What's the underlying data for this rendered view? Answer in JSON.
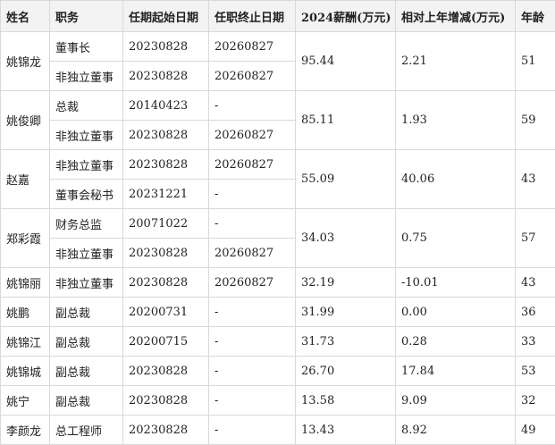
{
  "headers": [
    "姓名",
    "职务",
    "任期起始日期",
    "任职终止日期",
    "2024薪酬(万元)",
    "相对上年增减(万元)",
    "年龄"
  ],
  "people": [
    {
      "name": "姚锦龙",
      "salary": "95.44",
      "change": "2.21",
      "age": "51",
      "roles": [
        {
          "title": "董事长",
          "start": "20230828",
          "end": "20260827"
        },
        {
          "title": "非独立董事",
          "start": "20230828",
          "end": "20260827"
        }
      ]
    },
    {
      "name": "姚俊卿",
      "salary": "85.11",
      "change": "1.93",
      "age": "59",
      "roles": [
        {
          "title": "总裁",
          "start": "20140423",
          "end": "-"
        },
        {
          "title": "非独立董事",
          "start": "20230828",
          "end": "20260827"
        }
      ]
    },
    {
      "name": "赵嘉",
      "salary": "55.09",
      "change": "40.06",
      "age": "43",
      "roles": [
        {
          "title": "非独立董事",
          "start": "20230828",
          "end": "20260827"
        },
        {
          "title": "董事会秘书",
          "start": "20231221",
          "end": "-"
        }
      ]
    },
    {
      "name": "郑彩霞",
      "salary": "34.03",
      "change": "0.75",
      "age": "57",
      "roles": [
        {
          "title": "财务总监",
          "start": "20071022",
          "end": "-"
        },
        {
          "title": "非独立董事",
          "start": "20230828",
          "end": "20260827"
        }
      ]
    },
    {
      "name": "姚锦丽",
      "salary": "32.19",
      "change": "-10.01",
      "age": "43",
      "roles": [
        {
          "title": "非独立董事",
          "start": "20230828",
          "end": "20260827"
        }
      ]
    },
    {
      "name": "姚鹏",
      "salary": "31.99",
      "change": "0.00",
      "age": "36",
      "roles": [
        {
          "title": "副总裁",
          "start": "20200731",
          "end": "-"
        }
      ]
    },
    {
      "name": "姚锦江",
      "salary": "31.73",
      "change": "0.28",
      "age": "33",
      "roles": [
        {
          "title": "副总裁",
          "start": "20200715",
          "end": "-"
        }
      ]
    },
    {
      "name": "姚锦城",
      "salary": "26.70",
      "change": "17.84",
      "age": "53",
      "roles": [
        {
          "title": "副总裁",
          "start": "20230828",
          "end": "-"
        }
      ]
    },
    {
      "name": "姚宁",
      "salary": "13.58",
      "change": "9.09",
      "age": "32",
      "roles": [
        {
          "title": "副总裁",
          "start": "20230828",
          "end": "-"
        }
      ]
    },
    {
      "name": "李颜龙",
      "salary": "13.43",
      "change": "8.92",
      "age": "49",
      "roles": [
        {
          "title": "总工程师",
          "start": "20230828",
          "end": "-"
        }
      ]
    }
  ]
}
